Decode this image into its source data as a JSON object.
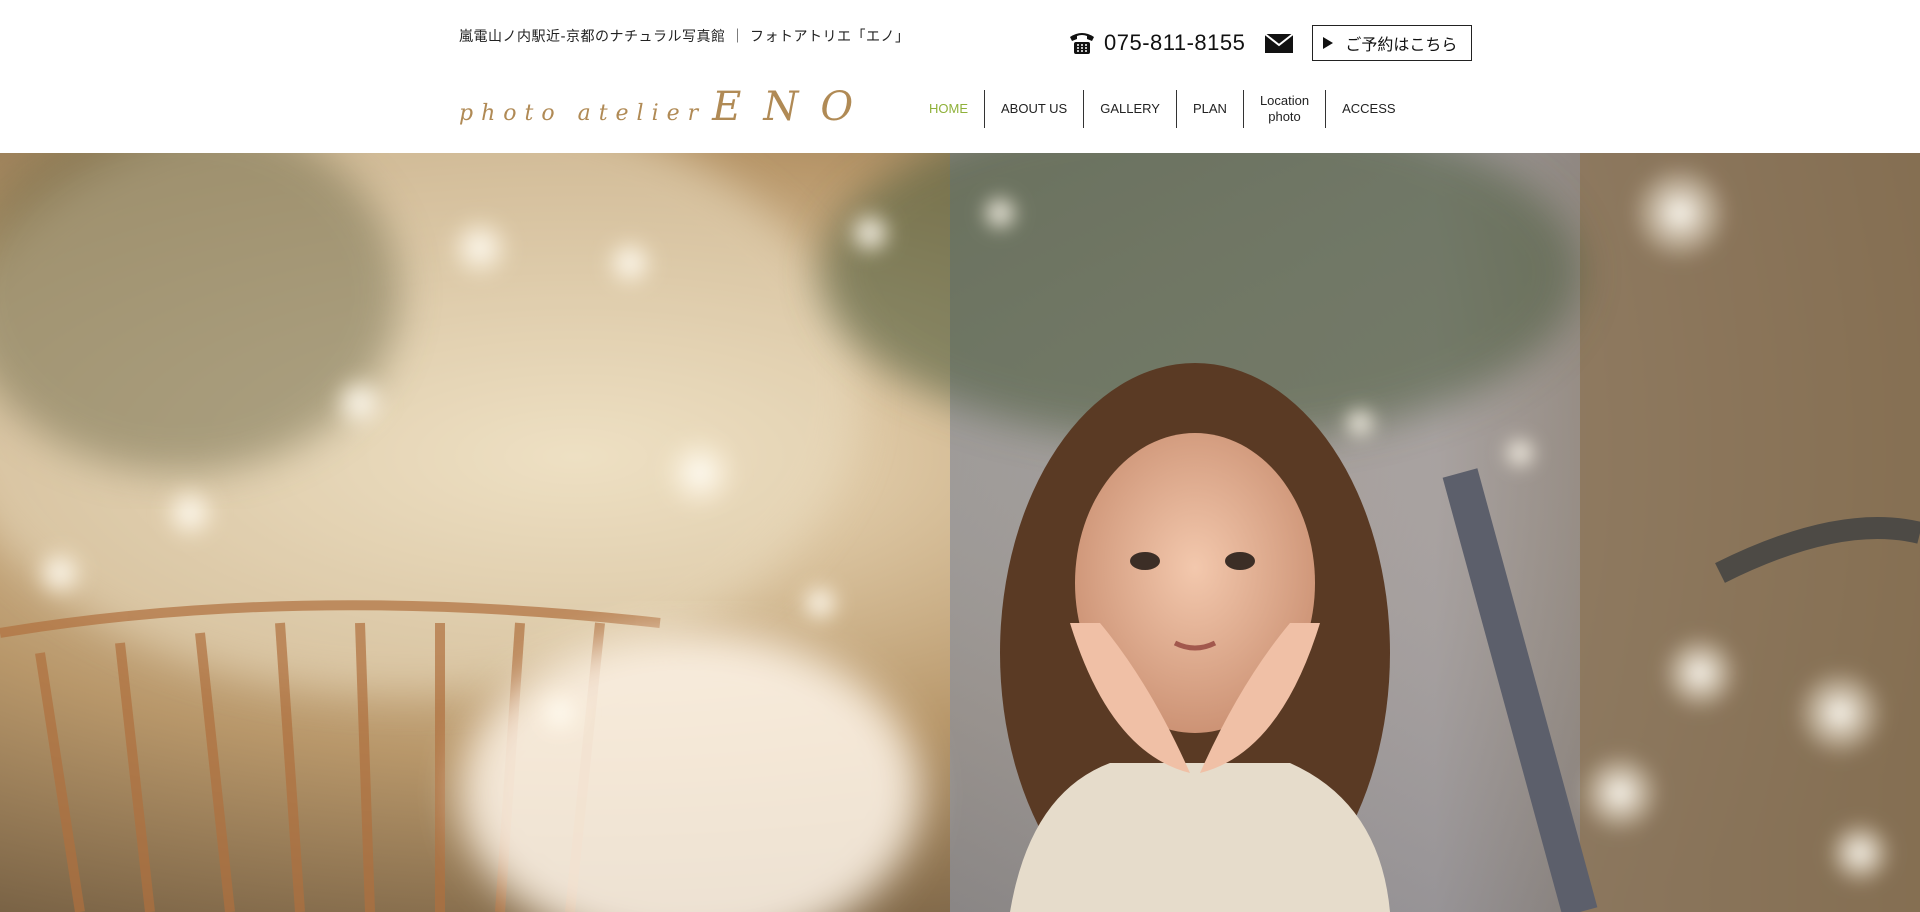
{
  "header": {
    "tagline": "嵐電山ノ内駅近-京都のナチュラル写真館 ｜ フォトアトリエ「エノ」",
    "phone_number": "075-811-8155",
    "reserve_label": "ご予約はこちら"
  },
  "logo": {
    "small_text": "photo atelier",
    "big_text": "ENO"
  },
  "nav": {
    "items": [
      {
        "label": "HOME",
        "active": true
      },
      {
        "label": "ABOUT US"
      },
      {
        "label": "GALLERY"
      },
      {
        "label": "PLAN"
      },
      {
        "label_line1": "Location",
        "label_line2": "photo"
      },
      {
        "label": "ACCESS"
      }
    ]
  },
  "icons": {
    "phone": "phone-icon",
    "mail": "mail-icon",
    "reserve_arrow": "play-arrow-icon"
  },
  "colors": {
    "accent_active": "#8fb13a",
    "logo": "#b08a55"
  }
}
